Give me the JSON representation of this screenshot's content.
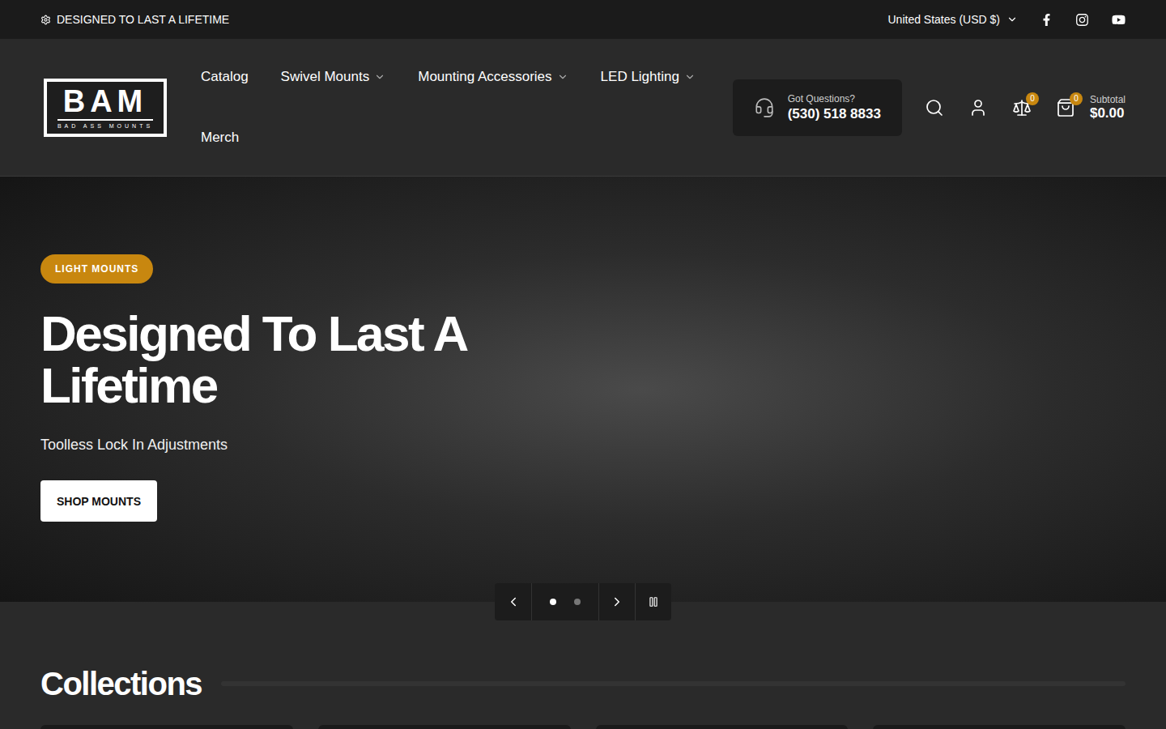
{
  "topbar": {
    "announcement": "DESIGNED TO LAST A LIFETIME",
    "currency": "United States (USD $)"
  },
  "logo": {
    "mark": "BAM",
    "tagline": "BAD ASS MOUNTS"
  },
  "nav": [
    {
      "label": "Catalog",
      "dropdown": false
    },
    {
      "label": "Swivel Mounts",
      "dropdown": true
    },
    {
      "label": "Mounting Accessories",
      "dropdown": true
    },
    {
      "label": "LED Lighting",
      "dropdown": true
    },
    {
      "label": "Merch",
      "dropdown": false
    }
  ],
  "contact": {
    "label": "Got Questions?",
    "phone": "(530) 518 8833"
  },
  "compare": {
    "count": "0"
  },
  "cart": {
    "count": "0",
    "label": "Subtotal",
    "amount": "$0.00"
  },
  "hero": {
    "tag": "LIGHT MOUNTS",
    "title": "Designed To Last A Lifetime",
    "subtitle": "Toolless Lock In Adjustments",
    "button": "SHOP MOUNTS"
  },
  "slider": {
    "dots": [
      {
        "selected": true
      },
      {
        "selected": false
      }
    ],
    "playing": true
  },
  "collections": {
    "title": "Collections"
  }
}
